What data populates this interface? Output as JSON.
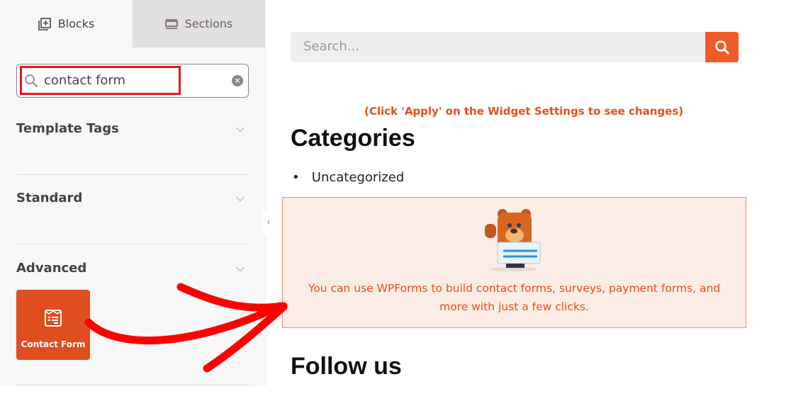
{
  "sidebar": {
    "tabs": [
      {
        "label": "Blocks",
        "icon": "add-block-icon",
        "active": true
      },
      {
        "label": "Sections",
        "icon": "sections-icon",
        "active": false
      }
    ],
    "search": {
      "value": "contact form"
    },
    "groups": [
      {
        "label": "Template Tags"
      },
      {
        "label": "Standard"
      },
      {
        "label": "Advanced"
      }
    ],
    "block": {
      "label": "Contact Form",
      "icon": "form-icon",
      "color": "#e04e1f"
    }
  },
  "main": {
    "search_placeholder": "Search...",
    "notice": "(Click 'Apply' on the Widget Settings to see changes)",
    "categories_title": "Categories",
    "categories": [
      "Uncategorized"
    ],
    "wpforms_message": "You can use WPForms to build contact forms, surveys, payment forms, and more with just a few clicks.",
    "follow_title": "Follow us",
    "accent": "#f15a29"
  }
}
